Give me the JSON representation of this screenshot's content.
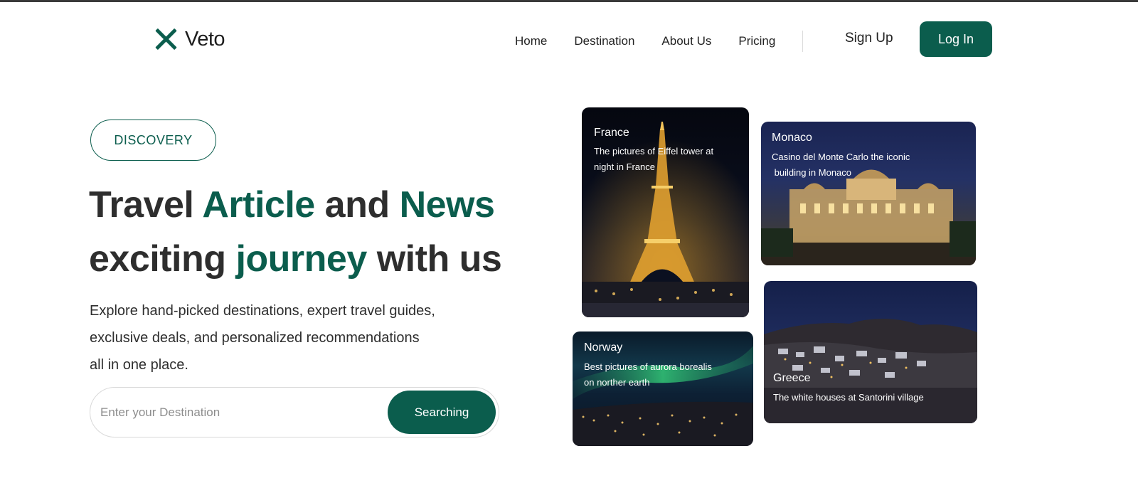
{
  "brand": {
    "name": "Veto",
    "icon": "x-logo-icon"
  },
  "nav": {
    "items": [
      "Home",
      "Destination",
      "About Us",
      "Pricing"
    ],
    "signup_label": "Sign Up",
    "login_label": "Log In"
  },
  "hero": {
    "badge": "DISCOVERY",
    "headline": {
      "w1": "Travel",
      "w2": "Article",
      "w3": "and",
      "w4": "News",
      "w5": "exciting",
      "w6": "journey",
      "w7": "with us"
    },
    "description_lines": [
      "Explore hand-picked destinations, expert travel guides,",
      "exclusive deals, and personalized recommendations",
      "all in one place."
    ],
    "search": {
      "placeholder": "Enter your Destination",
      "button_label": "Searching"
    }
  },
  "cards": [
    {
      "title": "France",
      "caption_lines": [
        "The pictures of Eiffel tower at",
        "night in France"
      ]
    },
    {
      "title": "Monaco",
      "caption_lines": [
        "Casino del Monte Carlo the iconic",
        " building in Monaco"
      ]
    },
    {
      "title": "Norway",
      "caption_lines": [
        "Best pictures of aurora borealis",
        "on norther earth"
      ]
    },
    {
      "title": "Greece",
      "caption_lines": [
        "The white houses at Santorini village"
      ]
    }
  ],
  "colors": {
    "accent": "#0b5d4d",
    "text": "#2e2e2e"
  }
}
